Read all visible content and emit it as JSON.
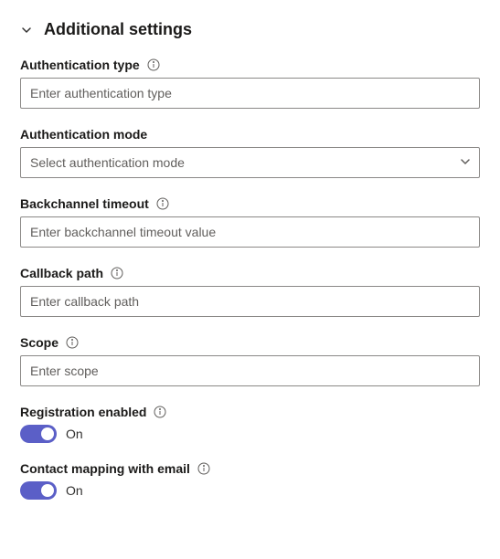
{
  "section": {
    "title": "Additional settings"
  },
  "fields": {
    "auth_type": {
      "label": "Authentication type",
      "placeholder": "Enter authentication type"
    },
    "auth_mode": {
      "label": "Authentication mode",
      "placeholder": "Select authentication mode"
    },
    "backchannel_timeout": {
      "label": "Backchannel timeout",
      "placeholder": "Enter backchannel timeout value"
    },
    "callback_path": {
      "label": "Callback path",
      "placeholder": "Enter callback path"
    },
    "scope": {
      "label": "Scope",
      "placeholder": "Enter scope"
    },
    "registration_enabled": {
      "label": "Registration enabled",
      "state_label": "On"
    },
    "contact_mapping": {
      "label": "Contact mapping with email",
      "state_label": "On"
    }
  }
}
